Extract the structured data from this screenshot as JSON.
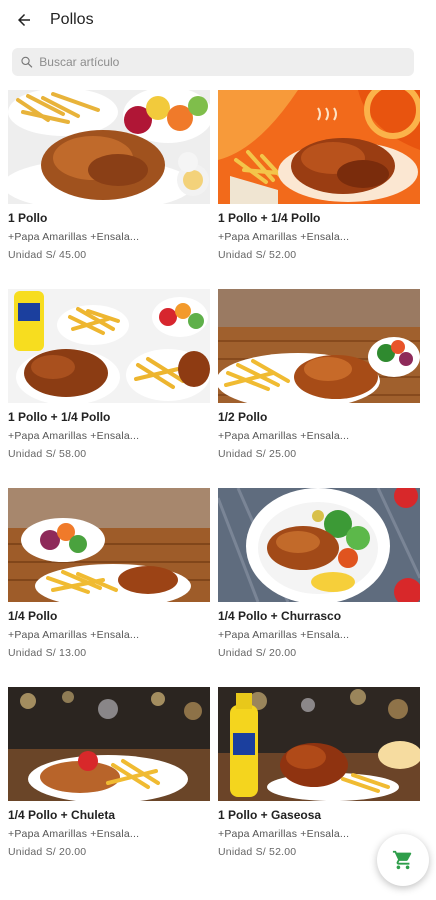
{
  "header": {
    "title": "Pollos",
    "back_icon": "arrow-back-icon"
  },
  "search": {
    "placeholder": "Buscar artículo",
    "icon": "search-icon"
  },
  "products": [
    {
      "name": "1 Pollo",
      "description": "+Papa Amarillas +Ensala...",
      "price": "Unidad S/ 45.00"
    },
    {
      "name": "1 Pollo + 1/4 Pollo",
      "description": "+Papa Amarillas +Ensala...",
      "price": "Unidad S/ 52.00"
    },
    {
      "name": "1 Pollo + 1/4 Pollo",
      "description": "+Papa Amarillas +Ensala...",
      "price": "Unidad S/ 58.00"
    },
    {
      "name": "1/2 Pollo",
      "description": "+Papa Amarillas +Ensala...",
      "price": "Unidad S/ 25.00"
    },
    {
      "name": "1/4 Pollo",
      "description": "+Papa Amarillas +Ensala...",
      "price": "Unidad S/ 13.00"
    },
    {
      "name": "1/4 Pollo + Churrasco",
      "description": "+Papa Amarillas +Ensala...",
      "price": "Unidad S/ 20.00"
    },
    {
      "name": "1/4 Pollo + Chuleta",
      "description": "+Papa Amarillas +Ensala...",
      "price": "Unidad S/ 20.00"
    },
    {
      "name": "1 Pollo + Gaseosa",
      "description": "+Papa Amarillas +Ensala...",
      "price": "Unidad S/ 52.00"
    }
  ],
  "cart": {
    "icon": "shopping-cart-icon",
    "color": "#2e9e4a"
  }
}
